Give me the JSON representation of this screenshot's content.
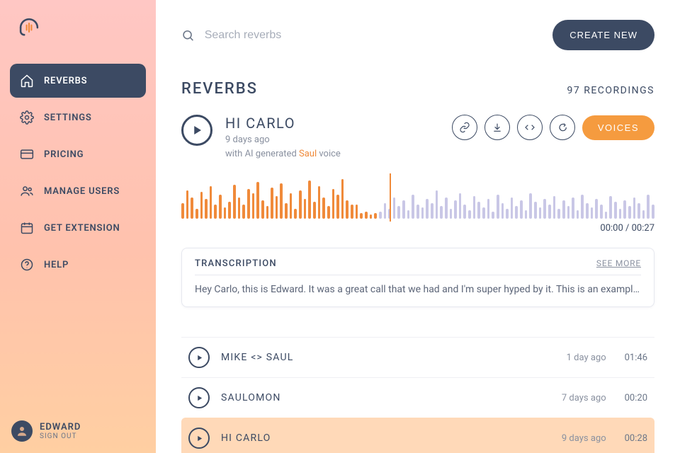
{
  "sidebar": {
    "items": [
      {
        "label": "REVERBS"
      },
      {
        "label": "SETTINGS"
      },
      {
        "label": "PRICING"
      },
      {
        "label": "MANAGE USERS"
      },
      {
        "label": "GET EXTENSION"
      },
      {
        "label": "HELP"
      }
    ]
  },
  "user": {
    "name": "EDWARD",
    "signout": "SIGN OUT"
  },
  "search": {
    "placeholder": "Search reverbs"
  },
  "create_label": "CREATE NEW",
  "page": {
    "title": "REVERBS",
    "count": "97 RECORDINGS"
  },
  "featured": {
    "title": "HI CARLO",
    "age": "9 days ago",
    "subline_prefix": "with AI generated ",
    "voice_name": "Saul",
    "subline_suffix": " voice",
    "time_current": "00:00",
    "time_total": "00:27",
    "voices_label": "VOICES"
  },
  "transcription": {
    "title": "TRANSCRIPTION",
    "see_more": "SEE MORE",
    "text": "Hey Carlo, this is Edward. It was a great call that we had and I'm super hyped by it. This is an example of  ..."
  },
  "recordings": [
    {
      "title": "MIKE <> SAUL",
      "age": "1 day ago",
      "duration": "01:46"
    },
    {
      "title": "SAULOMON",
      "age": "7 days ago",
      "duration": "00:20"
    },
    {
      "title": "HI CARLO",
      "age": "9 days ago",
      "duration": "00:28"
    }
  ],
  "waveform": {
    "played_heights": [
      22,
      40,
      30,
      14,
      38,
      28,
      46,
      20,
      34,
      16,
      24,
      48,
      30,
      20,
      42,
      36,
      52,
      26,
      18,
      44,
      32,
      50,
      22,
      36,
      14,
      40,
      28,
      54,
      24,
      46,
      30,
      18,
      42,
      34,
      56,
      26,
      20,
      20,
      8,
      10,
      6,
      8
    ],
    "unplayed_heights": [
      10,
      22,
      14,
      30,
      18,
      26,
      12,
      34,
      20,
      16,
      28,
      22,
      40,
      18,
      30,
      14,
      26,
      36,
      20,
      12,
      32,
      24,
      16,
      28,
      10,
      34,
      22,
      14,
      30,
      18,
      26,
      12,
      36,
      24,
      16,
      28,
      20,
      32,
      14,
      26,
      18,
      30,
      12,
      34,
      22,
      16,
      28,
      20,
      10,
      32,
      24,
      14,
      26,
      18,
      30,
      22,
      12,
      34,
      20
    ]
  }
}
